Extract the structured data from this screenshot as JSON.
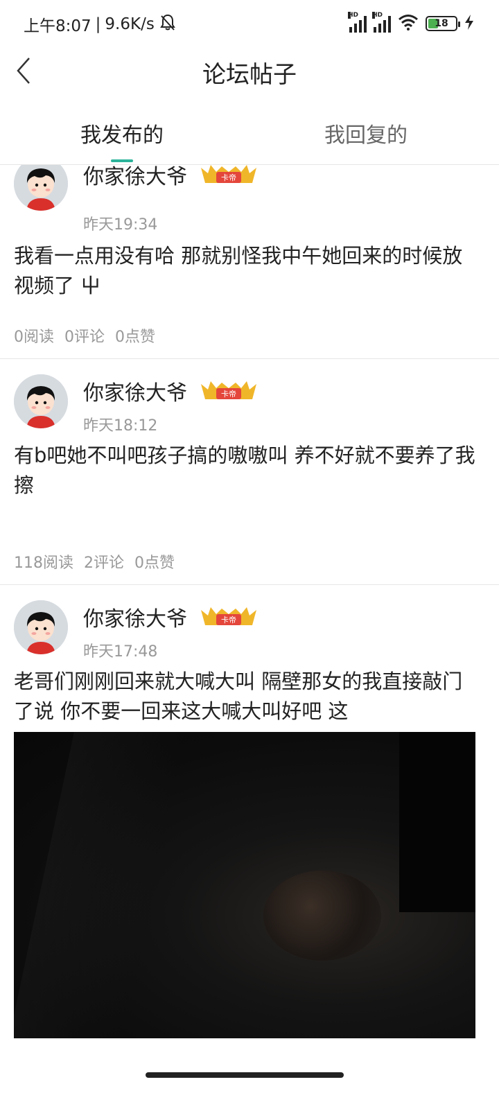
{
  "status_bar": {
    "time": "上午8:07",
    "separator": "|",
    "speed": "9.6K/s",
    "signal_label_1": "HD",
    "signal_label_2": "HD",
    "battery": "18"
  },
  "header": {
    "title": "论坛帖子"
  },
  "tabs": {
    "active": "我发布的",
    "inactive": "我回复的"
  },
  "posts": [
    {
      "username": "你家徐大爷",
      "badge": "卡帝",
      "time": "昨天19:34",
      "content": "我看一点用没有哈 那就别怪我中午她回来的时候放视频了 屮",
      "reads": "0阅读",
      "comments": "0评论",
      "likes": "0点赞"
    },
    {
      "username": "你家徐大爷",
      "badge": "卡帝",
      "time": "昨天18:12",
      "content": "有b吧她不叫吧孩子搞的嗷嗷叫 养不好就不要养了我擦",
      "reads": "118阅读",
      "comments": "2评论",
      "likes": "0点赞"
    },
    {
      "username": "你家徐大爷",
      "badge": "卡帝",
      "time": "昨天17:48",
      "content": "老哥们刚刚回来就大喊大叫 隔壁那女的我直接敲门了说 你不要一回来这大喊大叫好吧 这"
    }
  ]
}
